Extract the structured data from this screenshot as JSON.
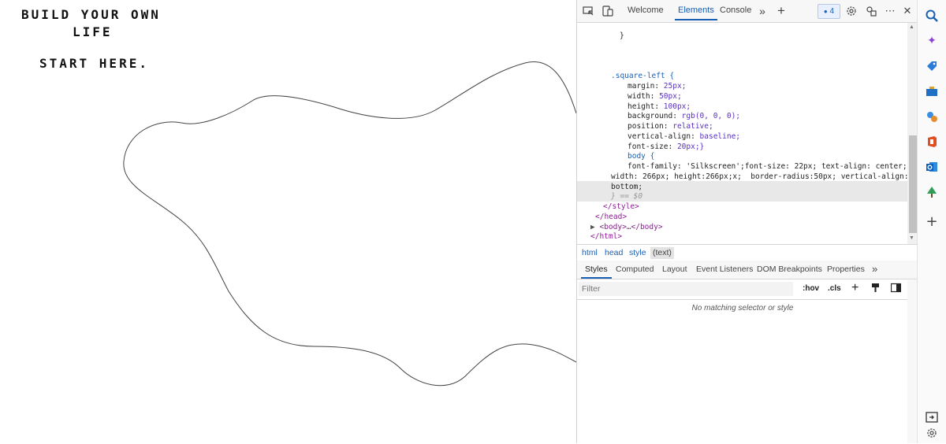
{
  "page": {
    "heading_line1": "BUILD YOUR OWN",
    "heading_line2": "LIFE",
    "subheading": "START HERE."
  },
  "devtools": {
    "toolbar": {
      "tabs": [
        "Welcome",
        "Elements",
        "Console"
      ],
      "active_tab": "Elements",
      "issues_count": "4",
      "icons": [
        "inspect-icon",
        "device-toggle-icon",
        "more-tabs-icon",
        "add-tab-icon",
        "settings-icon",
        "customize-icon",
        "more-options-icon",
        "close-icon"
      ]
    },
    "code_lines": [
      {
        "t": "}",
        "indent": 1
      },
      {
        "t": ".square-left {",
        "indent": 0
      },
      {
        "p": "margin",
        "v": "25px;"
      },
      {
        "p": "width",
        "v": "50px;"
      },
      {
        "p": "height",
        "v": "100px;"
      },
      {
        "p": "background",
        "v": "rgb(0, 0, 0);"
      },
      {
        "p": "position",
        "v": "relative;"
      },
      {
        "p": "vertical-align",
        "v": "baseline;"
      },
      {
        "p": "font-size",
        "v": "20px;}"
      },
      {
        "t": "body {"
      },
      {
        "t": "font-family: 'Silkscreen';font-size: 22px; text-align: center;"
      },
      {
        "t": "width: 266px; height:266px;x;  border-radius:50px; vertical-align:"
      },
      {
        "t": "bottom;"
      },
      {
        "t": "} == $0"
      },
      {
        "t": "</style>"
      },
      {
        "t": "</head>"
      },
      {
        "t": "<body>…</body>"
      },
      {
        "t": "</html>"
      }
    ],
    "breadcrumbs": [
      "html",
      "head",
      "style",
      "(text)"
    ],
    "pane_tabs": [
      "Styles",
      "Computed",
      "Layout",
      "Event Listeners",
      "DOM Breakpoints",
      "Properties"
    ],
    "active_pane_tab": "Styles",
    "filter_placeholder": "Filter",
    "filter_tools": {
      "hov": ":hov",
      "cls": ".cls",
      "add": "+"
    },
    "no_match": "No matching selector or style"
  },
  "sidebar": {
    "icons": [
      "search-icon",
      "copilot-icon",
      "shopping-icon",
      "tools-icon",
      "games-icon",
      "office-icon",
      "outlook-icon",
      "tree-icon",
      "add-icon",
      "sidebar-toggle-icon",
      "settings-icon"
    ]
  },
  "colors": {
    "accent": "#1a5fb4",
    "tag": "#8a1d91",
    "value": "#5a2fc0",
    "string": "#c01f1f"
  }
}
